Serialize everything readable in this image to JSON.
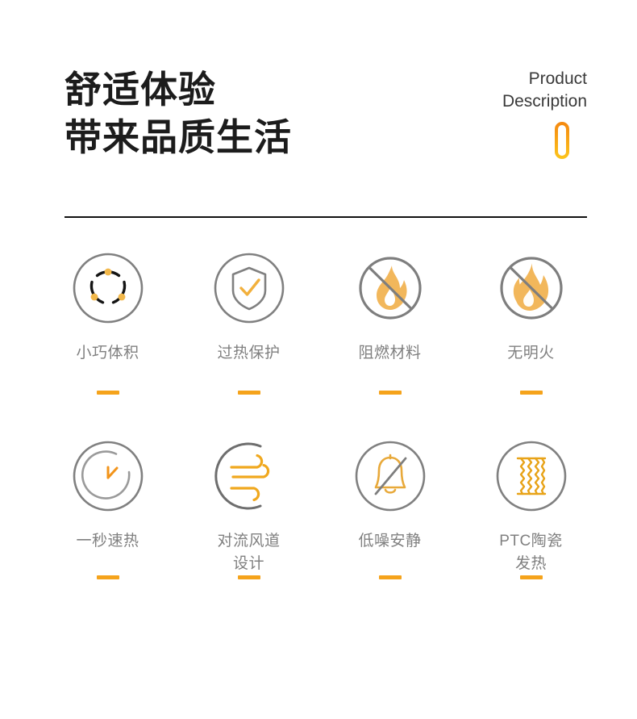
{
  "header": {
    "headline_line1": "舒适体验",
    "headline_line2": "带来品质生活",
    "eyebrow_line1": "Product",
    "eyebrow_line2": "Description",
    "accent_icon": "orange-pill-outline-icon"
  },
  "colors": {
    "accent_orange": "#F5A31B",
    "accent_gold": "#F2B84B",
    "ring_gray": "#808080",
    "text_gray": "#808080",
    "headline_black": "#1c1c1c"
  },
  "features": {
    "row1": [
      {
        "label": "小巧体积",
        "icon": "compact-size-icon"
      },
      {
        "label": "过热保护",
        "icon": "shield-check-icon"
      },
      {
        "label": "阻燃材料",
        "icon": "no-flame-slash-icon"
      },
      {
        "label": "无明火",
        "icon": "no-open-fire-icon"
      }
    ],
    "row2": [
      {
        "label": "一秒速热",
        "icon": "fast-heat-clock-icon"
      },
      {
        "label": "对流风道\n设计",
        "icon": "airflow-convection-icon"
      },
      {
        "label": "低噪安静",
        "icon": "mute-bell-icon"
      },
      {
        "label": "PTC陶瓷\n发热",
        "icon": "ptc-ceramic-heating-icon"
      }
    ]
  }
}
